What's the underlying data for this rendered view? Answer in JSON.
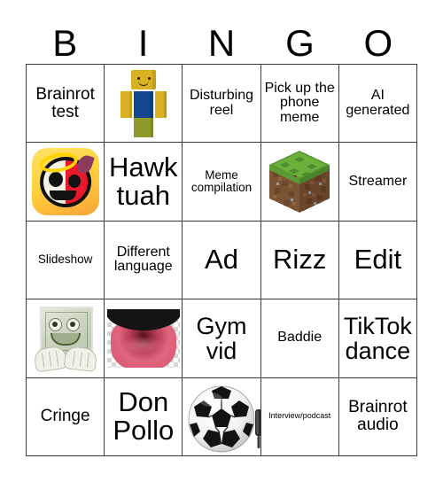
{
  "card": {
    "title": "BINGO",
    "header_letters": [
      "B",
      "I",
      "N",
      "G",
      "O"
    ],
    "grid_size": "5x5",
    "border_color": "#3a3a3a",
    "background_color": "#ffffff",
    "text_color": "#000000"
  },
  "cells": [
    {
      "id": "b1",
      "column": "B",
      "row": 1,
      "type": "text",
      "text": "Brainrot test",
      "size": "lg"
    },
    {
      "id": "i1",
      "column": "I",
      "row": 1,
      "type": "image",
      "text": "",
      "image": "roblox-noob",
      "alt": "Roblox noob character"
    },
    {
      "id": "n1",
      "column": "N",
      "row": 1,
      "type": "text",
      "text": "Disturbing reel",
      "size": "md"
    },
    {
      "id": "g1",
      "column": "G",
      "row": 1,
      "type": "text",
      "text": "Pick up the phone meme",
      "size": "md"
    },
    {
      "id": "o1",
      "column": "O",
      "row": 1,
      "type": "text",
      "text": "AI generated",
      "size": "md"
    },
    {
      "id": "b2",
      "column": "B",
      "row": 2,
      "type": "image",
      "text": "",
      "image": "angel-devil-skull-emoji",
      "alt": "Angel and devil skull emoji"
    },
    {
      "id": "i2",
      "column": "I",
      "row": 2,
      "type": "text",
      "text": "Hawk tuah",
      "size": "xxl"
    },
    {
      "id": "n2",
      "column": "N",
      "row": 2,
      "type": "text",
      "text": "Meme compilation",
      "size": "sm"
    },
    {
      "id": "g2",
      "column": "G",
      "row": 2,
      "type": "image",
      "text": "",
      "image": "minecraft-grass-block",
      "alt": "Minecraft grass block"
    },
    {
      "id": "o2",
      "column": "O",
      "row": 2,
      "type": "text",
      "text": "Streamer",
      "size": "md"
    },
    {
      "id": "b3",
      "column": "B",
      "row": 3,
      "type": "text",
      "text": "Slideshow",
      "size": "sm"
    },
    {
      "id": "i3",
      "column": "I",
      "row": 3,
      "type": "text",
      "text": "Different language",
      "size": "md"
    },
    {
      "id": "n3",
      "column": "N",
      "row": 3,
      "type": "text",
      "text": "Ad",
      "size": "xxl"
    },
    {
      "id": "g3",
      "column": "G",
      "row": 3,
      "type": "text",
      "text": "Rizz",
      "size": "xxl"
    },
    {
      "id": "o3",
      "column": "O",
      "row": 3,
      "type": "text",
      "text": "Edit",
      "size": "xxl"
    },
    {
      "id": "b4",
      "column": "B",
      "row": 4,
      "type": "image",
      "text": "",
      "image": "money-man-meme",
      "alt": "Dollar bill face meme"
    },
    {
      "id": "i4",
      "column": "I",
      "row": 4,
      "type": "image",
      "text": "",
      "image": "mouth-tongue",
      "alt": "Open mouth with tongue"
    },
    {
      "id": "n4",
      "column": "N",
      "row": 4,
      "type": "text",
      "text": "Gym vid",
      "size": "xl"
    },
    {
      "id": "g4",
      "column": "G",
      "row": 4,
      "type": "text",
      "text": "Baddie",
      "size": "md"
    },
    {
      "id": "o4",
      "column": "O",
      "row": 4,
      "type": "text",
      "text": "TikTok dance",
      "size": "xl"
    },
    {
      "id": "b5",
      "column": "B",
      "row": 5,
      "type": "text",
      "text": "Cringe",
      "size": "lg"
    },
    {
      "id": "i5",
      "column": "I",
      "row": 5,
      "type": "text",
      "text": "Don Pollo",
      "size": "xxl"
    },
    {
      "id": "n5",
      "column": "N",
      "row": 5,
      "type": "image",
      "text": "",
      "image": "soccer-ball",
      "alt": "Soccer ball with pump"
    },
    {
      "id": "g5",
      "column": "G",
      "row": 5,
      "type": "text",
      "text": "Interview/podcast",
      "size": "xs"
    },
    {
      "id": "o5",
      "column": "O",
      "row": 5,
      "type": "text",
      "text": "Brainrot audio",
      "size": "lg"
    }
  ]
}
